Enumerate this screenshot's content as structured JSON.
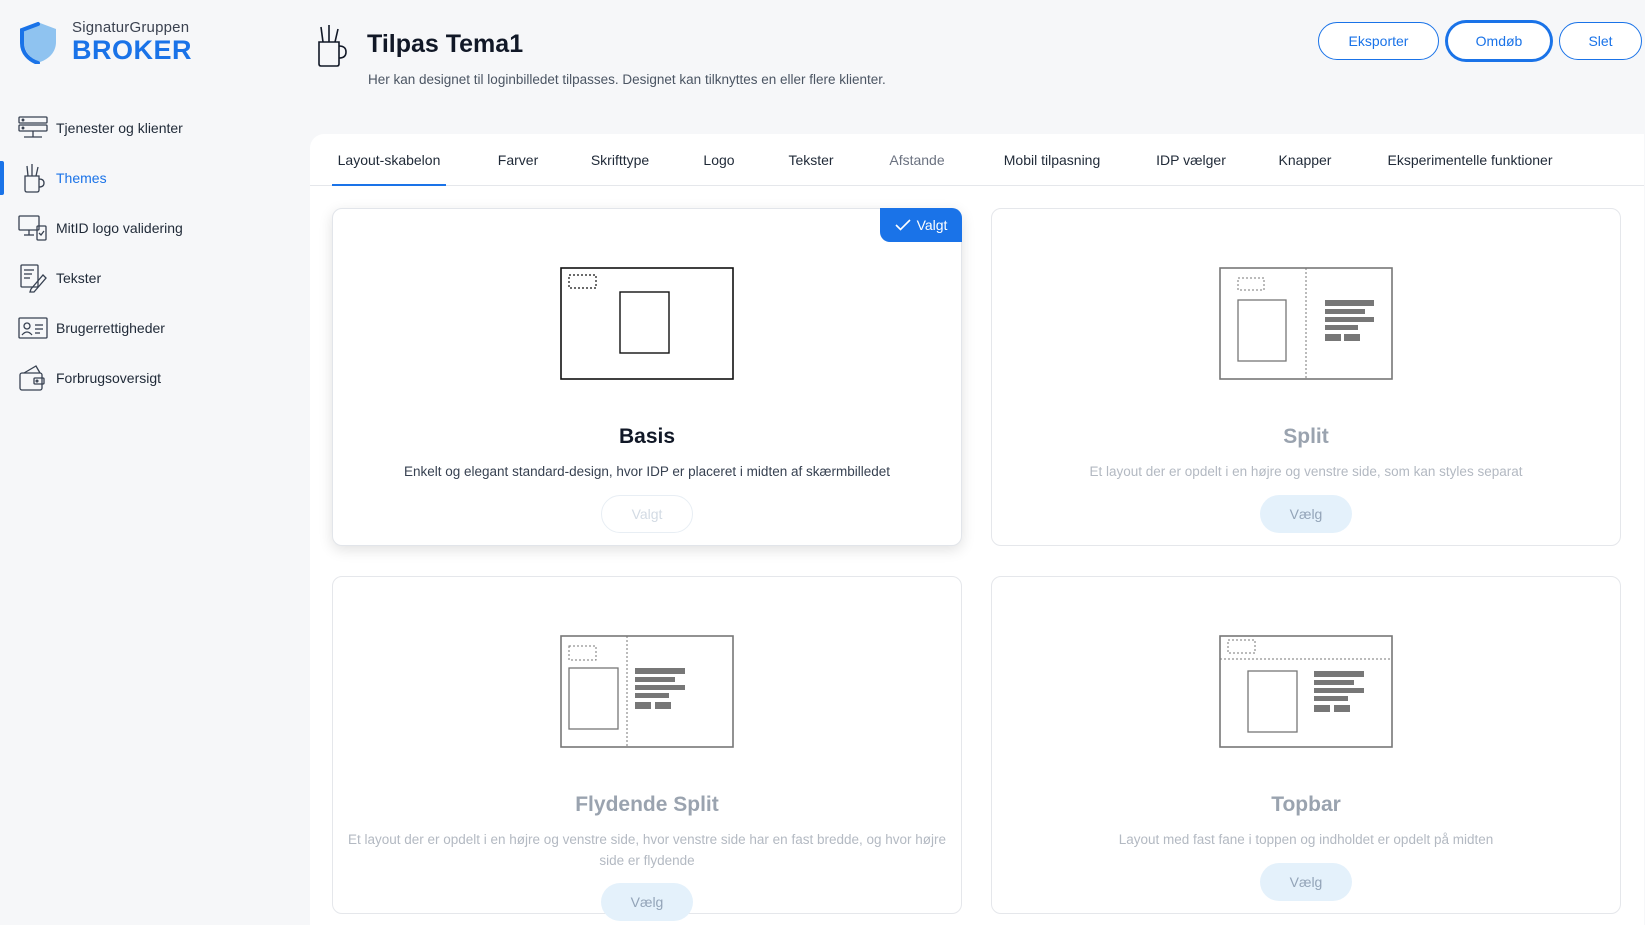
{
  "brand": {
    "small": "SignaturGruppen",
    "big": "BROKER"
  },
  "sidebar": {
    "items": [
      {
        "label": "Tjenester og klienter",
        "icon": "server-icon"
      },
      {
        "label": "Themes",
        "icon": "brush-cup-icon",
        "active": true
      },
      {
        "label": "MitID logo validering",
        "icon": "monitor-check-icon"
      },
      {
        "label": "Tekster",
        "icon": "edit-document-icon"
      },
      {
        "label": "Brugerrettigheder",
        "icon": "user-card-icon"
      },
      {
        "label": "Forbrugsoversigt",
        "icon": "wallet-icon"
      }
    ]
  },
  "header": {
    "title": "Tilpas Tema1",
    "subtitle": "Her kan designet til loginbilledet tilpasses. Designet kan tilknyttes en eller flere klienter."
  },
  "actions": {
    "export": "Eksporter",
    "rename": "Omdøb",
    "delete": "Slet"
  },
  "tabs": [
    {
      "label": "Layout-skabelon",
      "active": true
    },
    {
      "label": "Farver"
    },
    {
      "label": "Skrifttype"
    },
    {
      "label": "Logo"
    },
    {
      "label": "Tekster"
    },
    {
      "label": "Afstande",
      "muted": true
    },
    {
      "label": "Mobil tilpasning"
    },
    {
      "label": "IDP vælger"
    },
    {
      "label": "Knapper"
    },
    {
      "label": "Eksperimentelle funktioner"
    }
  ],
  "cards": [
    {
      "title": "Basis",
      "desc": "Enkelt og elegant standard-design, hvor IDP er placeret i midten af skærmbilledet",
      "button": "Valgt",
      "badge": "Valgt",
      "selected": true
    },
    {
      "title": "Split",
      "desc": "Et layout der er opdelt i en højre og venstre side, som kan styles separat",
      "button": "Vælg"
    },
    {
      "title": "Flydende Split",
      "desc": "Et layout der er opdelt i en højre og venstre side, hvor venstre side har en fast bredde, og hvor højre side er flydende",
      "button": "Vælg"
    },
    {
      "title": "Topbar",
      "desc": "Layout med fast fane i toppen og indholdet er opdelt på midten",
      "button": "Vælg"
    }
  ]
}
